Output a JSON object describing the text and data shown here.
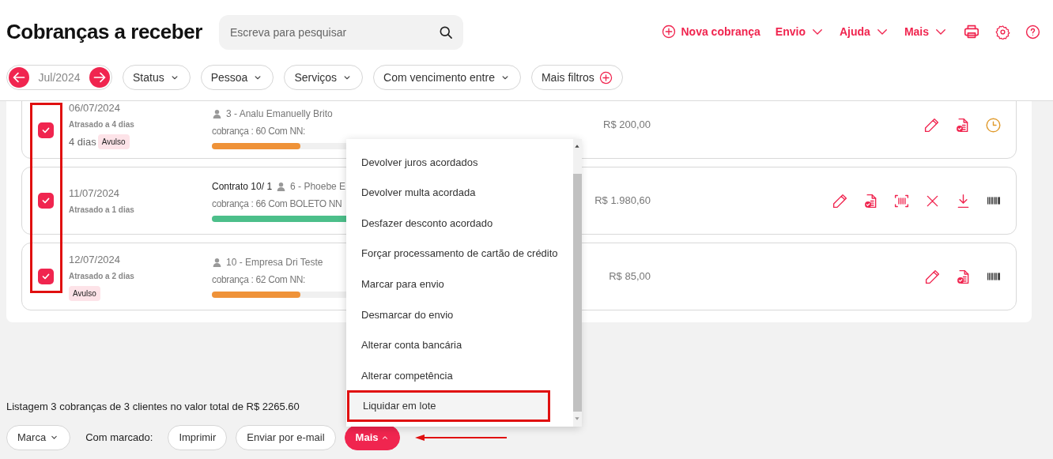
{
  "title": "Cobranças a receber",
  "search": {
    "placeholder": "Escreva para pesquisar"
  },
  "nav": [
    {
      "label": "Nova cobrança",
      "kind": "add"
    },
    {
      "label": "Envio",
      "kind": "dropdown"
    },
    {
      "label": "Ajuda",
      "kind": "dropdown"
    },
    {
      "label": "Mais",
      "kind": "dropdown"
    },
    {
      "kind": "print"
    },
    {
      "kind": "settings"
    },
    {
      "kind": "help"
    }
  ],
  "period": "Jul/2024",
  "filters": [
    {
      "label": "Status",
      "kind": "dropdown"
    },
    {
      "label": "Pessoa",
      "kind": "dropdown"
    },
    {
      "label": "Serviços",
      "kind": "dropdown"
    },
    {
      "label": "Com vencimento entre",
      "kind": "dropdown"
    },
    {
      "label": "Mais filtros",
      "kind": "add"
    }
  ],
  "checkboxes_highlighted": true,
  "rows": [
    {
      "checked": true,
      "date": "06/07/2024",
      "late": "Atrasado a 4 dias",
      "days": "4 dias",
      "tag": "Avulso",
      "person": "3 - Analu Emanuelly Brito",
      "charge": "cobrança : 60 Com NN:",
      "level": 0.5,
      "color": "#ef9238",
      "amount": "R$ 200,00",
      "actions": [
        {
          "kind": "edit"
        },
        {
          "kind": "document"
        },
        {
          "kind": "clock"
        }
      ]
    },
    {
      "checked": true,
      "date": "11/07/2024",
      "late": "Atrasado a 1 dias",
      "contract": "Contrato 10/ 1",
      "person": "6 - Phoebe E",
      "charge": "cobrança : 66 Com BOLETO NN",
      "level": 1,
      "color": "#4cbf8a",
      "amount": "R$ 1.980,60",
      "actions": [
        {
          "kind": "edit"
        },
        {
          "kind": "document"
        },
        {
          "kind": "scan"
        },
        {
          "kind": "close"
        },
        {
          "kind": "download"
        },
        {
          "kind": "barcode"
        }
      ]
    },
    {
      "checked": true,
      "date": "12/07/2024",
      "late": "Atrasado a 2 dias",
      "tag": "Avulso",
      "person": "10 - Empresa Dri Teste",
      "charge": "cobrança : 62 Com NN:",
      "level": 0.5,
      "color": "#ef9238",
      "amount": "R$ 85,00",
      "actions": [
        {
          "kind": "edit"
        },
        {
          "kind": "document"
        },
        {
          "kind": "barcode"
        }
      ]
    }
  ],
  "menu": [
    {
      "label": "Devolver juros acordados",
      "highlighted": false
    },
    {
      "label": "Devolver multa acordada",
      "highlighted": false
    },
    {
      "label": "Desfazer desconto acordado",
      "highlighted": false
    },
    {
      "label": "Forçar processamento de cartão de crédito",
      "highlighted": false
    },
    {
      "label": "Marcar para envio",
      "highlighted": false
    },
    {
      "label": "Desmarcar do envio",
      "highlighted": false
    },
    {
      "label": "Alterar conta bancária",
      "highlighted": false
    },
    {
      "label": "Alterar competência",
      "highlighted": false
    },
    {
      "label": "Liquidar em lote",
      "highlighted": true
    }
  ],
  "summary": "Listagem 3 cobranças de 3 clientes no valor total de R$ 2265.60",
  "bottom": [
    {
      "label": "Marca",
      "kind": "dropdown"
    },
    {
      "label": "Com marcado:",
      "kind": "label"
    },
    {
      "label": "Imprimir",
      "kind": "button"
    },
    {
      "label": "Enviar por e-mail",
      "kind": "button"
    },
    {
      "label": "Mais",
      "kind": "primary",
      "annotated": true
    }
  ]
}
